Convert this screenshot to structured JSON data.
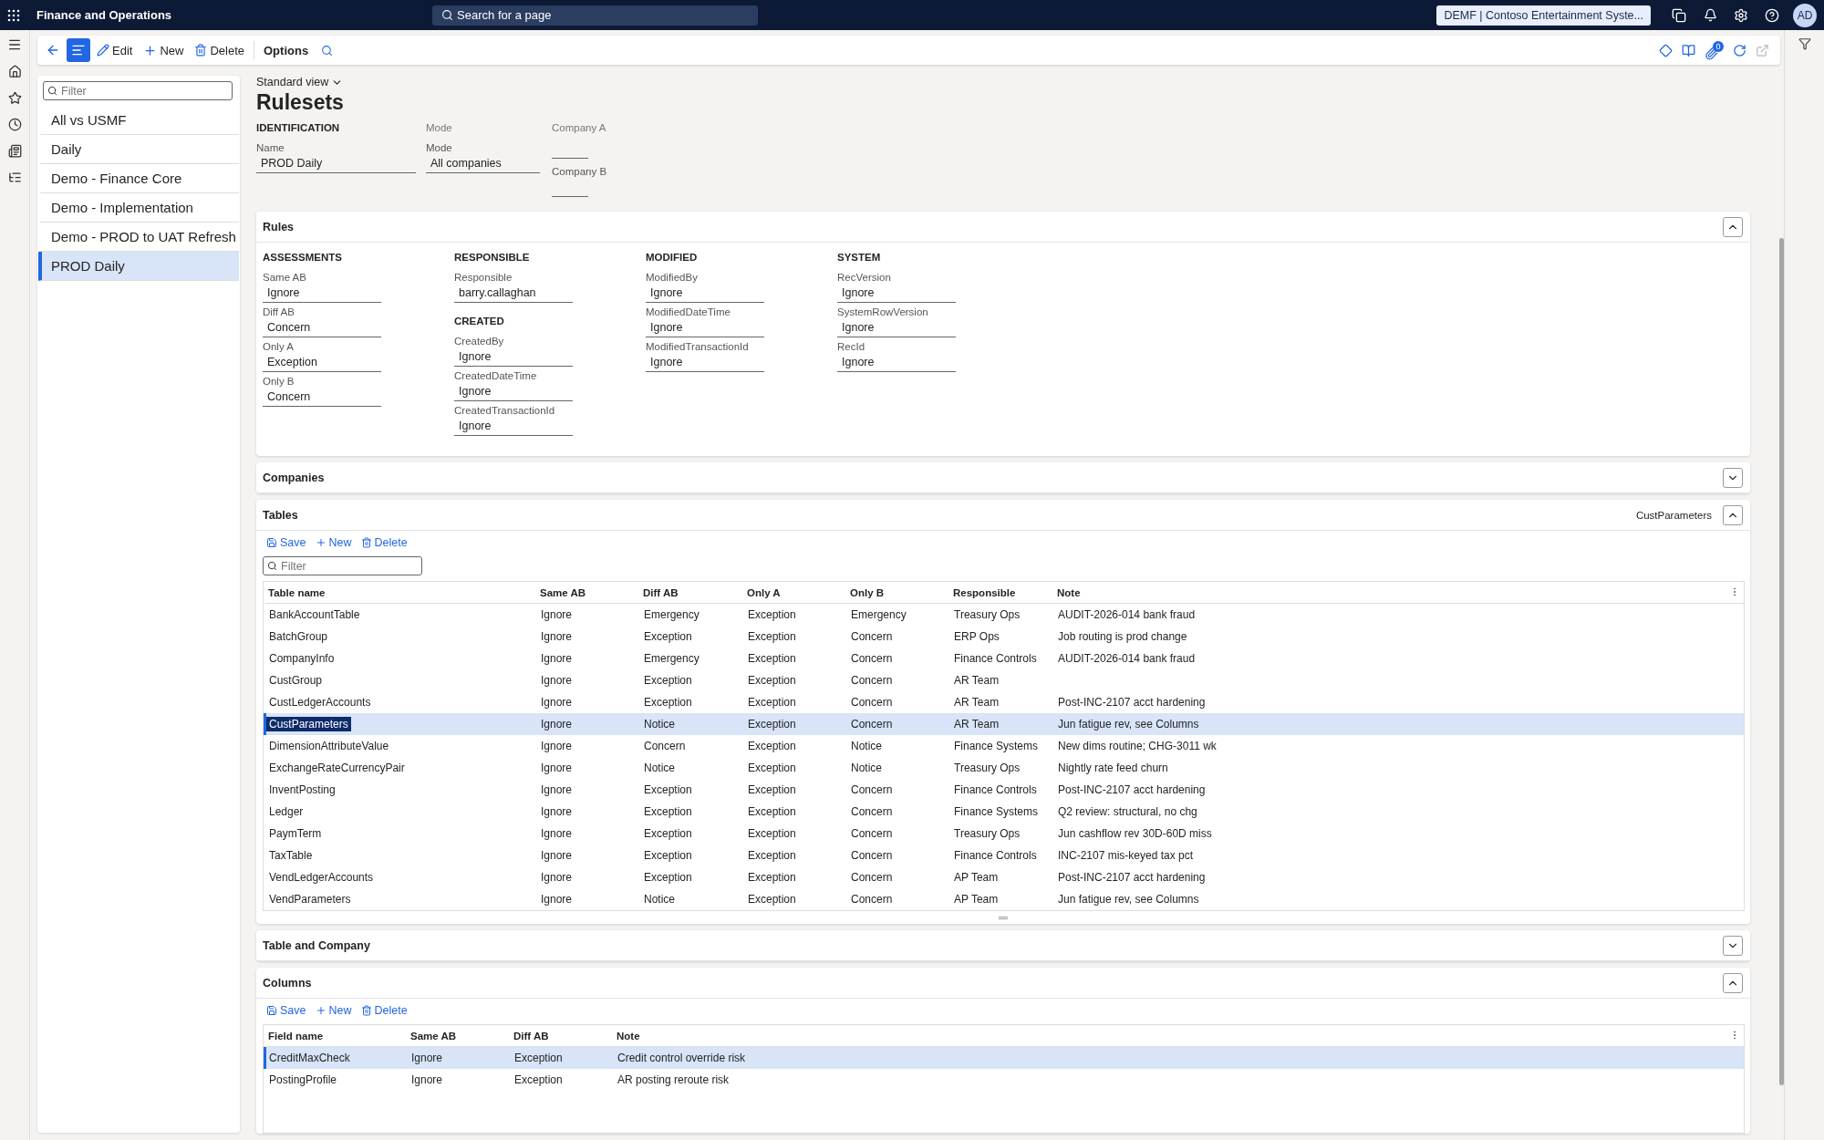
{
  "app": {
    "title": "Finance and Operations",
    "search_placeholder": "Search for a page",
    "company": "DEMF | Contoso Entertainment Syste...",
    "avatar": "AD",
    "attachments_count": "0"
  },
  "action_bar": {
    "list_view_on": true,
    "buttons": [
      "Edit",
      "New",
      "Delete",
      "Options"
    ]
  },
  "nav_list": {
    "filter_placeholder": "Filter",
    "items": [
      {
        "label": "All vs USMF",
        "selected": false
      },
      {
        "label": "Daily",
        "selected": false
      },
      {
        "label": "Demo - Finance Core",
        "selected": false
      },
      {
        "label": "Demo - Implementation",
        "selected": false
      },
      {
        "label": "Demo - PROD to UAT Refresh",
        "selected": false
      },
      {
        "label": "PROD Daily",
        "selected": true
      }
    ]
  },
  "view": "Standard view",
  "title": "Rulesets",
  "identification": {
    "heading": "IDENTIFICATION",
    "name_label": "Name",
    "name_value": "PROD Daily",
    "mode_heading": "Mode",
    "mode_label": "Mode",
    "mode_value": "All companies",
    "company_a_label": "Company A",
    "company_b_label": "Company B"
  },
  "rules": {
    "title": "Rules",
    "expanded": true,
    "columns": [
      {
        "groups": [
          {
            "heading": "ASSESSMENTS",
            "fields": [
              {
                "label": "Same AB",
                "value": "Ignore"
              },
              {
                "label": "Diff AB",
                "value": "Concern"
              },
              {
                "label": "Only A",
                "value": "Exception"
              },
              {
                "label": "Only B",
                "value": "Concern"
              }
            ]
          }
        ]
      },
      {
        "groups": [
          {
            "heading": "RESPONSIBLE",
            "fields": [
              {
                "label": "Responsible",
                "value": "barry.callaghan"
              }
            ]
          },
          {
            "heading": "CREATED",
            "fields": [
              {
                "label": "CreatedBy",
                "value": "Ignore"
              },
              {
                "label": "CreatedDateTime",
                "value": "Ignore"
              },
              {
                "label": "CreatedTransactionId",
                "value": "Ignore"
              }
            ]
          }
        ]
      },
      {
        "groups": [
          {
            "heading": "MODIFIED",
            "fields": [
              {
                "label": "ModifiedBy",
                "value": "Ignore"
              },
              {
                "label": "ModifiedDateTime",
                "value": "Ignore"
              },
              {
                "label": "ModifiedTransactionId",
                "value": "Ignore"
              }
            ]
          }
        ]
      },
      {
        "groups": [
          {
            "heading": "SYSTEM",
            "fields": [
              {
                "label": "RecVersion",
                "value": "Ignore"
              },
              {
                "label": "SystemRowVersion",
                "value": "Ignore"
              },
              {
                "label": "RecId",
                "value": "Ignore"
              }
            ]
          }
        ]
      }
    ]
  },
  "companies": {
    "title": "Companies",
    "expanded": false
  },
  "tables": {
    "title": "Tables",
    "expanded": true,
    "summary": "CustParameters",
    "toolbar": [
      "Save",
      "New",
      "Delete"
    ],
    "filter_placeholder": "Filter",
    "columns": [
      "Table name",
      "Same AB",
      "Diff AB",
      "Only A",
      "Only B",
      "Responsible",
      "Note"
    ],
    "rows": [
      {
        "cells": [
          "BankAccountTable",
          "Ignore",
          "Emergency",
          "Exception",
          "Emergency",
          "Treasury Ops",
          "AUDIT-2026-014 bank fraud"
        ],
        "selected": false,
        "name_highlighted": false
      },
      {
        "cells": [
          "BatchGroup",
          "Ignore",
          "Exception",
          "Exception",
          "Concern",
          "ERP Ops",
          "Job routing is prod change"
        ],
        "selected": false,
        "name_highlighted": false
      },
      {
        "cells": [
          "CompanyInfo",
          "Ignore",
          "Emergency",
          "Exception",
          "Concern",
          "Finance Controls",
          "AUDIT-2026-014 bank fraud"
        ],
        "selected": false,
        "name_highlighted": false
      },
      {
        "cells": [
          "CustGroup",
          "Ignore",
          "Exception",
          "Exception",
          "Concern",
          "AR Team",
          ""
        ],
        "selected": false,
        "name_highlighted": false
      },
      {
        "cells": [
          "CustLedgerAccounts",
          "Ignore",
          "Exception",
          "Exception",
          "Concern",
          "AR Team",
          "Post-INC-2107 acct hardening"
        ],
        "selected": false,
        "name_highlighted": false
      },
      {
        "cells": [
          "CustParameters",
          "Ignore",
          "Notice",
          "Exception",
          "Concern",
          "AR Team",
          "Jun fatigue rev, see Columns"
        ],
        "selected": true,
        "name_highlighted": true
      },
      {
        "cells": [
          "DimensionAttributeValue",
          "Ignore",
          "Concern",
          "Exception",
          "Notice",
          "Finance Systems",
          "New dims routine; CHG-3011 wk"
        ],
        "selected": false,
        "name_highlighted": false
      },
      {
        "cells": [
          "ExchangeRateCurrencyPair",
          "Ignore",
          "Notice",
          "Exception",
          "Notice",
          "Treasury Ops",
          "Nightly rate feed churn"
        ],
        "selected": false,
        "name_highlighted": false
      },
      {
        "cells": [
          "InventPosting",
          "Ignore",
          "Exception",
          "Exception",
          "Concern",
          "Finance Controls",
          "Post-INC-2107 acct hardening"
        ],
        "selected": false,
        "name_highlighted": false
      },
      {
        "cells": [
          "Ledger",
          "Ignore",
          "Exception",
          "Exception",
          "Concern",
          "Finance Systems",
          "Q2 review: structural, no chg"
        ],
        "selected": false,
        "name_highlighted": false
      },
      {
        "cells": [
          "PaymTerm",
          "Ignore",
          "Exception",
          "Exception",
          "Concern",
          "Treasury Ops",
          "Jun cashflow rev 30D-60D miss"
        ],
        "selected": false,
        "name_highlighted": false
      },
      {
        "cells": [
          "TaxTable",
          "Ignore",
          "Exception",
          "Exception",
          "Concern",
          "Finance Controls",
          "INC-2107 mis-keyed tax pct"
        ],
        "selected": false,
        "name_highlighted": false
      },
      {
        "cells": [
          "VendLedgerAccounts",
          "Ignore",
          "Exception",
          "Exception",
          "Concern",
          "AP Team",
          "Post-INC-2107 acct hardening"
        ],
        "selected": false,
        "name_highlighted": false
      },
      {
        "cells": [
          "VendParameters",
          "Ignore",
          "Notice",
          "Exception",
          "Concern",
          "AP Team",
          "Jun fatigue rev, see Columns"
        ],
        "selected": false,
        "name_highlighted": false
      }
    ]
  },
  "table_and_company": {
    "title": "Table and Company",
    "expanded": false
  },
  "columns_section": {
    "title": "Columns",
    "expanded": true,
    "toolbar": [
      "Save",
      "New",
      "Delete"
    ],
    "columns": [
      "Field name",
      "Same AB",
      "Diff AB",
      "Note"
    ],
    "rows": [
      {
        "cells": [
          "CreditMaxCheck",
          "Ignore",
          "Exception",
          "Credit control override risk"
        ],
        "selected": true
      },
      {
        "cells": [
          "PostingProfile",
          "Ignore",
          "Exception",
          "AR posting reroute risk"
        ],
        "selected": false
      }
    ]
  }
}
